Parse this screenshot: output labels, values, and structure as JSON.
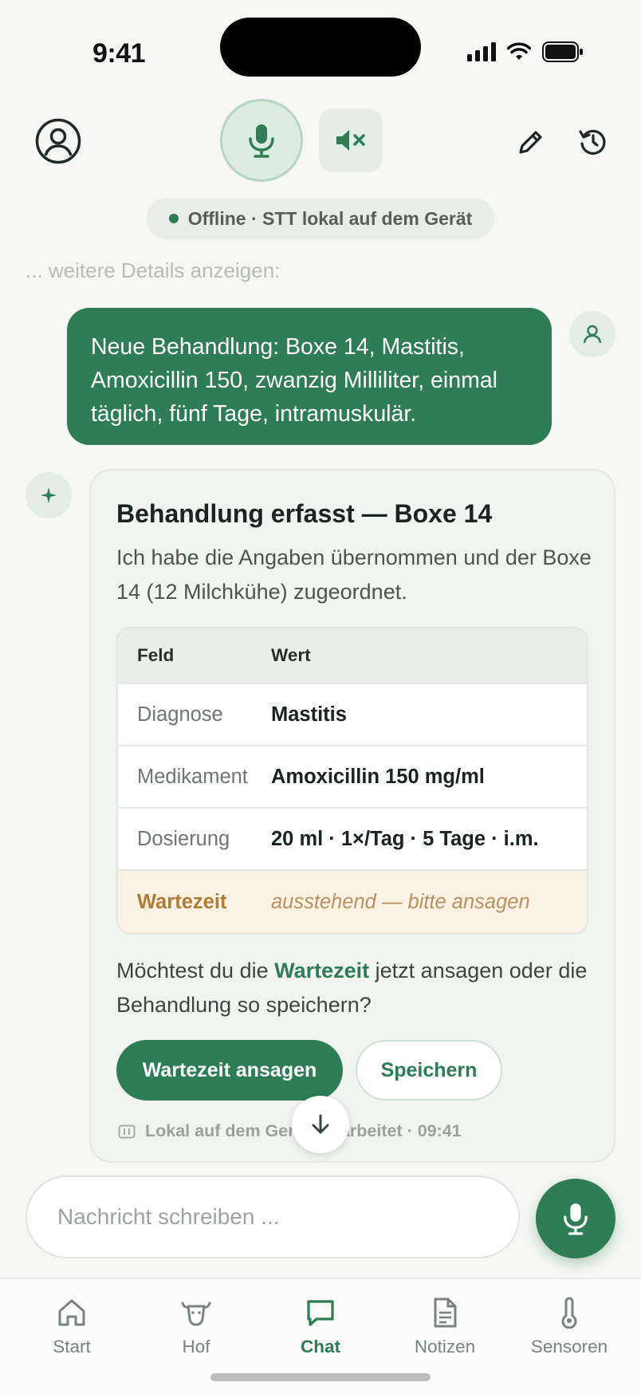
{
  "status_bar": {
    "time": "9:41"
  },
  "offline_status": "Offline · STT lokal auf dem Gerät",
  "more_details": "... weitere Details anzeigen:",
  "user_message": "Neue Behandlung: Boxe 14, Mastitis, Amoxicillin 150, zwanzig Milliliter, einmal täglich, fünf Tage, intramuskulär.",
  "ai_card": {
    "title": "Behandlung erfasst — Boxe 14",
    "intro": "Ich habe die Angaben übernommen und der Boxe 14 (12 Milchkühe) zugeordnet.",
    "table": {
      "headers": [
        "Feld",
        "Wert"
      ],
      "rows": [
        [
          "Diagnose",
          "Mastitis"
        ],
        [
          "Medikament",
          "Amoxicillin 150 mg/ml"
        ],
        [
          "Dosierung",
          "20 ml · 1×/Tag · 5 Tage · i.m."
        ],
        [
          "Wartezeit",
          "ausstehend — bitte ansagen"
        ]
      ]
    },
    "question_pre": "Möchtest du die ",
    "question_bold": "Wartezeit",
    "question_post": " jetzt ansagen oder die Behandlung so speichern?",
    "primary_button": "Wartezeit ansagen",
    "secondary_button": "Speichern",
    "footer": "Lokal auf dem Gerät verarbeitet · 09:41"
  },
  "composer": {
    "placeholder": "Nachricht schreiben ..."
  },
  "tabs": [
    {
      "label": "Start",
      "icon": "home-icon"
    },
    {
      "label": "Hof",
      "icon": "cow-icon"
    },
    {
      "label": "Chat",
      "icon": "chat-icon",
      "active": true
    },
    {
      "label": "Notizen",
      "icon": "document-icon"
    },
    {
      "label": "Sensoren",
      "icon": "thermometer-icon"
    }
  ],
  "colors": {
    "accent": "#2e7d55",
    "warning": "#b07b34",
    "warning_bg": "#fbf2e4"
  }
}
